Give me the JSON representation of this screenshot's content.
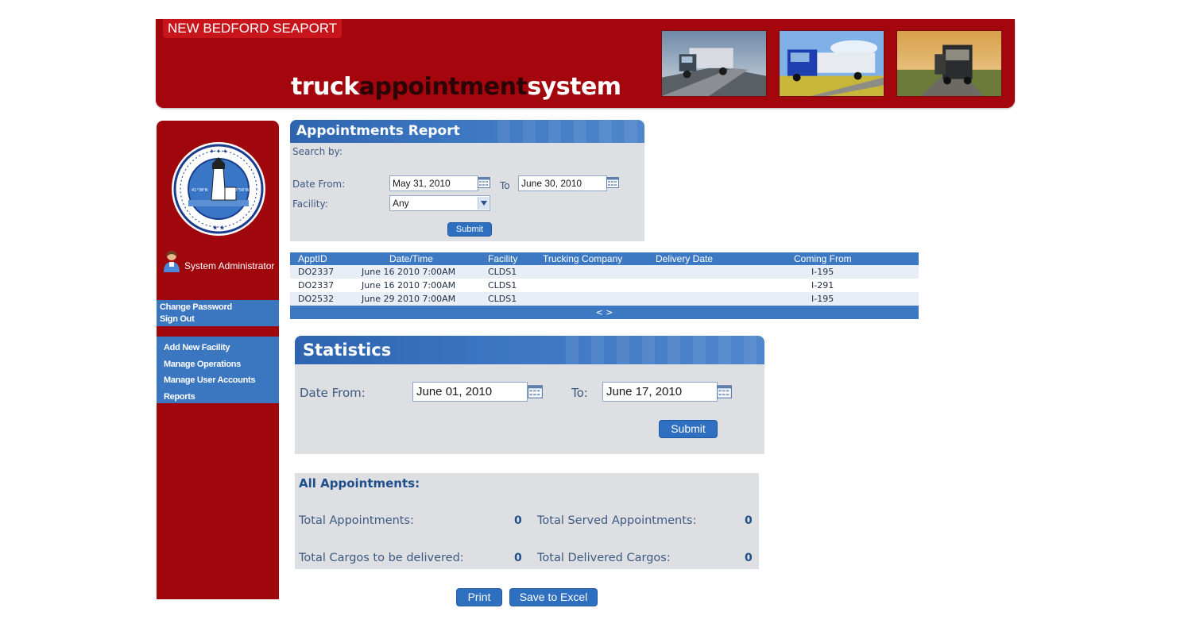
{
  "header": {
    "brand": "NEW BEDFORD SEAPORT",
    "title_part1": "truck",
    "title_part2": "appointment",
    "title_part3": "system"
  },
  "sidebar": {
    "user_name": "System Administrator",
    "account_links": [
      {
        "label": "Change Password"
      },
      {
        "label": "Sign Out"
      }
    ],
    "menu_links": [
      {
        "label": "Add New Facility"
      },
      {
        "label": "Manage Operations"
      },
      {
        "label": "Manage User Accounts"
      },
      {
        "label": "Reports"
      }
    ]
  },
  "report": {
    "title": "Appointments Report",
    "search_by_label": "Search by:",
    "date_from_label": "Date From:",
    "date_from_value": "May 31, 2010",
    "to_label": "To",
    "date_to_value": "June 30, 2010",
    "facility_label": "Facility:",
    "facility_selected": "Any",
    "submit_label": "Submit"
  },
  "results": {
    "columns": [
      "ApptID",
      "Date/Time",
      "Facility",
      "Trucking Company",
      "Delivery Date",
      "Coming From"
    ],
    "rows": [
      {
        "appt_id": "DO2337",
        "date_time": "June 16 2010 7:00AM",
        "facility": "CLDS1",
        "trucking_company": "",
        "delivery_date": "",
        "coming_from": "I-195"
      },
      {
        "appt_id": "DO2337",
        "date_time": "June 16 2010 7:00AM",
        "facility": "CLDS1",
        "trucking_company": "",
        "delivery_date": "",
        "coming_from": "I-291"
      },
      {
        "appt_id": "DO2532",
        "date_time": "June 29 2010 7:00AM",
        "facility": "CLDS1",
        "trucking_company": "",
        "delivery_date": "",
        "coming_from": "I-195"
      }
    ],
    "pager": "< >"
  },
  "statistics": {
    "title": "Statistics",
    "date_from_label": "Date From:",
    "date_from_value": "June 01, 2010",
    "to_label": "To:",
    "date_to_value": "June 17, 2010",
    "submit_label": "Submit"
  },
  "totals": {
    "heading": "All Appointments:",
    "total_appointments_label": "Total Appointments:",
    "total_appointments_value": "0",
    "total_served_label": "Total Served Appointments:",
    "total_served_value": "0",
    "total_cargos_label": "Total Cargos to be delivered:",
    "total_cargos_value": "0",
    "total_delivered_label": "Total Delivered Cargos:",
    "total_delivered_value": "0"
  },
  "actions": {
    "print_label": "Print",
    "excel_label": "Save to Excel"
  },
  "colors": {
    "brand_red": "#a3070d",
    "nav_blue": "#3b77c1",
    "panel_gray": "#dedfe3"
  }
}
